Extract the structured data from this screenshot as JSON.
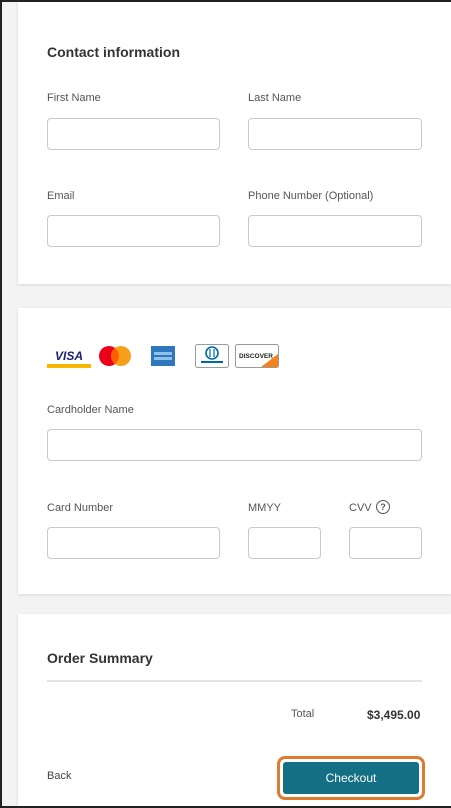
{
  "contact": {
    "title": "Contact information",
    "first_name": {
      "label": "First Name",
      "value": ""
    },
    "last_name": {
      "label": "Last Name",
      "value": ""
    },
    "email": {
      "label": "Email",
      "value": ""
    },
    "phone": {
      "label": "Phone Number (Optional)",
      "value": ""
    }
  },
  "payment": {
    "card_logos": [
      {
        "icon": "visa-logo-icon",
        "text": "VISA",
        "color": "#1a1f71"
      },
      {
        "icon": "mastercard-logo-icon",
        "colors": [
          "#eb001b",
          "#f79e1b"
        ]
      },
      {
        "icon": "amex-logo-icon",
        "color": "#2e77bc"
      },
      {
        "icon": "diners-club-logo-icon",
        "color": "#0069aa"
      },
      {
        "icon": "discover-logo-icon",
        "text": "DISCOVER",
        "color": "#f58220"
      }
    ],
    "cardholder_name": {
      "label": "Cardholder Name",
      "value": ""
    },
    "card_number": {
      "label": "Card Number",
      "value": ""
    },
    "mmyy": {
      "label": "MMYY",
      "value": ""
    },
    "cvv": {
      "label": "CVV",
      "value": "",
      "help_icon": "question-circle-icon",
      "help_glyph": "?"
    }
  },
  "summary": {
    "title": "Order Summary",
    "total_label": "Total",
    "total_value": "$3,495.00",
    "back_label": "Back",
    "checkout_label": "Checkout",
    "accent_color": "#126f84",
    "focus_color": "#e07a2f"
  }
}
